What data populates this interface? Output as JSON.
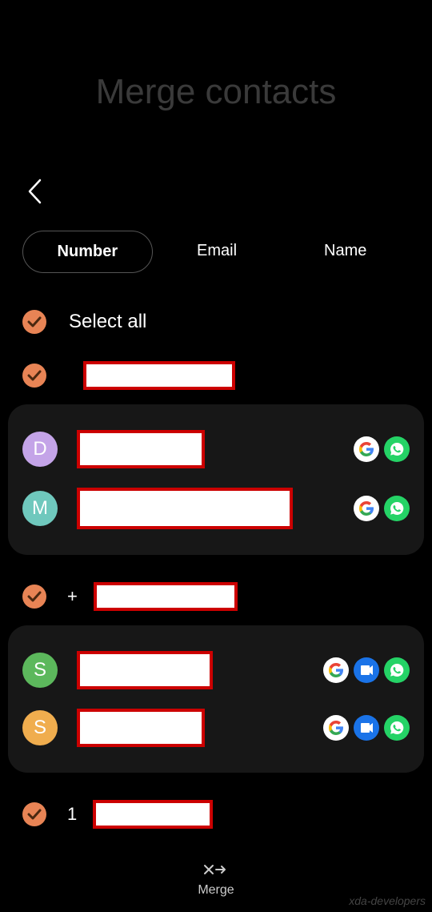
{
  "header": {
    "title": "Merge contacts"
  },
  "tabs": [
    {
      "label": "Number",
      "active": true
    },
    {
      "label": "Email",
      "active": false
    },
    {
      "label": "Name",
      "active": false
    }
  ],
  "selectAll": {
    "label": "Select all",
    "checked": true
  },
  "groups": [
    {
      "checked": true,
      "prefix": "",
      "contacts": [
        {
          "initial": "D",
          "avatarColor": "#c4a4e8",
          "icons": [
            "google",
            "whatsapp"
          ]
        },
        {
          "initial": "M",
          "avatarColor": "#6fc8bd",
          "icons": [
            "google",
            "whatsapp"
          ]
        }
      ]
    },
    {
      "checked": true,
      "prefix": "+",
      "contacts": [
        {
          "initial": "S",
          "avatarColor": "#5cb85c",
          "icons": [
            "google",
            "duo",
            "whatsapp"
          ]
        },
        {
          "initial": "S",
          "avatarColor": "#f0ad4e",
          "icons": [
            "google",
            "duo",
            "whatsapp"
          ]
        }
      ]
    },
    {
      "checked": true,
      "prefix": "1",
      "contacts": []
    }
  ],
  "bottomAction": {
    "label": "Merge"
  },
  "watermark": "xda-developers"
}
